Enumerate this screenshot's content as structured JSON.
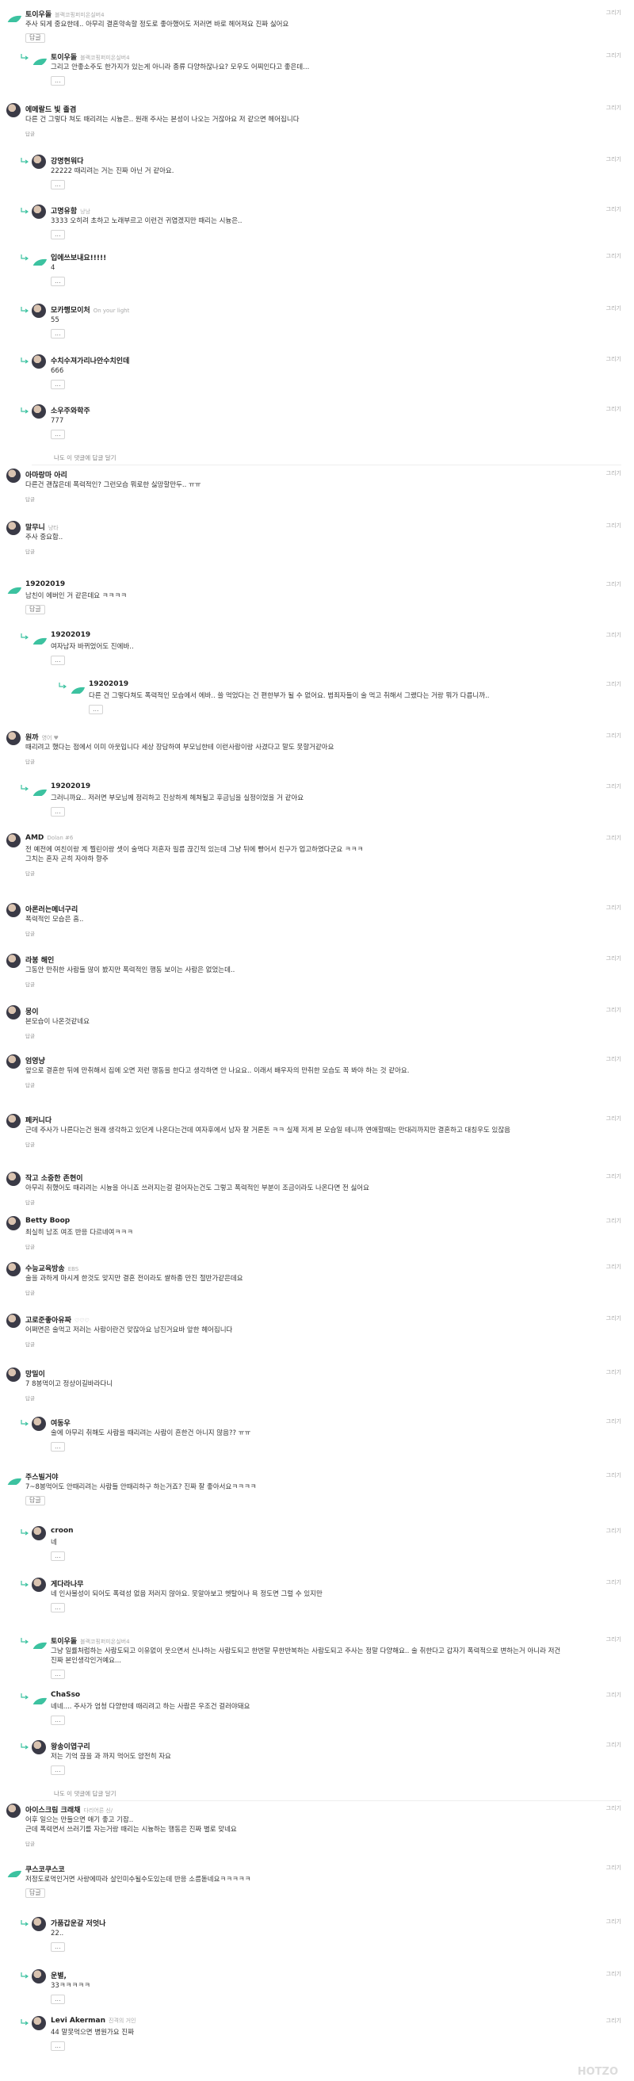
{
  "report_label": "그리기",
  "reply_label": "답글",
  "more_label": "...",
  "view_replies_label": "나도 이 댓글에 답글 달기",
  "watermark": "HOTZO",
  "leaf_color": "#3cc2a0",
  "comments": [
    {
      "nick": "토이우돌",
      "tag": "블랙코핑퍼미온실버4",
      "body": "주사 되게 중요한데.. 아무리 결혼약속할 정도로 좋아했어도 저러면 바로 헤어져요 진짜 싫어요",
      "avatar": "leaf",
      "depth": 0
    },
    {
      "nick": "토이우돌",
      "tag": "블랙코핑퍼미온실버4",
      "body": "그리고 안좋소주도 한가지가 있는게 아니라 종류 다양하잖나요? 모우도 어찌인다고 좋은데...",
      "avatar": "leaf",
      "depth": 1
    },
    {
      "nick": "에메랄드 빛 졸겸",
      "tag": "",
      "body": "다른 건 그렇다 쳐도 때리려는 시늉은.. 원래 주사는 본성이 나오는 거잖아요 저 같으면 헤어집니다",
      "avatar": "photo",
      "depth": 0
    },
    {
      "nick": "강명현워다",
      "tag": "",
      "body": "22222 때리려는 거는 진짜 아닌 거 같아요.",
      "avatar": "photo",
      "depth": 1
    },
    {
      "nick": "고명유함",
      "tag": "낭낭",
      "body": "3333 오히려 초하고 노래부르고 이런건 귀엽겠지만 때리는 시늉은..",
      "avatar": "photo",
      "depth": 1
    },
    {
      "nick": "입에쓰보내요!!!!!",
      "tag": "",
      "body": "4",
      "avatar": "leaf",
      "depth": 1
    },
    {
      "nick": "모카행모이처",
      "tag": "On your light",
      "body": "55",
      "avatar": "photo",
      "depth": 1
    },
    {
      "nick": "수치수져가리나안수치인데",
      "tag": "",
      "body": "666",
      "avatar": "photo",
      "depth": 1
    },
    {
      "nick": "소우주와학주",
      "tag": "",
      "body": "777",
      "avatar": "photo",
      "depth": 1
    },
    {
      "viewmore": true,
      "depth": 1
    },
    {
      "nick": "아마랑마 아리",
      "tag": "",
      "body": "다른건 괜찮은데 폭력적인? 그런모습 뭐로한 싫망할만두.. ㅠㅠ",
      "avatar": "photo",
      "depth": 0
    },
    {
      "nick": "말무니",
      "tag": "냥타",
      "body": "주사 중요함..",
      "avatar": "photo",
      "depth": 0
    },
    {
      "nick": "19202019",
      "tag": "",
      "body": "남친이 에버인 거 같은데요 ㅋㅋㅋㅋ",
      "avatar": "leaf",
      "depth": 0
    },
    {
      "nick": "19202019",
      "tag": "",
      "body": "여자남자 바뀌었어도 진에바..",
      "avatar": "leaf",
      "depth": 1
    },
    {
      "nick": "19202019",
      "tag": "",
      "body": "다른 건 그렇다쳐도 폭력적인 모습에서 에바.. 쓸 먹었다는 건 편한부가 될 수 없어요. 범죄자들이 술 먹고 취해서 그랬다는 거랑 뭐가 다릅니까..",
      "avatar": "leaf",
      "depth": 2
    },
    {
      "nick": "원까",
      "tag": "영어 ♥",
      "body": "때리려고 했다는 점에서 이미 아웃입니다 세상 장담하여 부모님한테 이런사람이랑 사겼다고 말도 못할거같아요",
      "avatar": "photo",
      "depth": 0
    },
    {
      "nick": "19202019",
      "tag": "",
      "body": "그러니까요.. 저러면 부모님께 정리하고 진상하게 헤쳐될고 후금님을 실정이었을 거 같아요",
      "avatar": "leaf",
      "depth": 1
    },
    {
      "nick": "AMD",
      "tag": "Dolan #6",
      "body": "전 예전에 여친이랑 계 찔린이랑 셋이 술먹다 저혼자 필름 끊긴적 있는데 그냥 뒤에 빵어서 친구가 업고하였다군요 ㅋㅋㅋ\n그치는 혼자 곤히 자야하 향주",
      "avatar": "photo",
      "depth": 0
    },
    {
      "nick": "아론러는메너구리",
      "tag": "",
      "body": "폭력적인 모습은 흠..",
      "avatar": "photo",
      "depth": 0
    },
    {
      "nick": "라봉 해인",
      "tag": "",
      "body": "그동안 만취한 사람들 많이 봤지만 폭력적인 행동 보이는 사람은 없었는데..",
      "avatar": "photo",
      "depth": 0
    },
    {
      "nick": "몽이",
      "tag": "",
      "body": "본모습이 나온것같네요",
      "avatar": "photo",
      "depth": 0
    },
    {
      "nick": "엄영냥",
      "tag": "",
      "body": "앞으로 결혼한 뒤에 만취해서 집에 오면 저런 행동을 한다고 생각하면 안 나요요.. 이래서 배우자의 만취한 모습도 꼭 봐야 하는 것 같아요.",
      "avatar": "photo",
      "depth": 0
    },
    {
      "nick": "페커니다",
      "tag": "",
      "body": "근데 주사가 나른다는건 원래 생각하고 있던게 나온다는건데 여자후에서 남자 잘 거론돈 ㅋㅋ 실제 저게 본 모습일 테니까 연애할때는 만대리까지만 결혼하고 대칭우도 있잖음",
      "avatar": "photo",
      "depth": 0
    },
    {
      "nick": "작고 소중한 존현이",
      "tag": "",
      "body": "아무리 취했어도 때리려는 시늉을 아니죠 쓰러지는걸 걸어자는건도 그렇고 폭력적인 부분이 조금이라도 나온다면 전 싫어요",
      "avatar": "photo",
      "depth": 0
    },
    {
      "nick": "Betty Boop",
      "tag": "",
      "body": "최실히 남조 여조 반응 다르네여ㅋㅋㅋ",
      "avatar": "photo",
      "depth": 0
    },
    {
      "nick": "수능교육방송",
      "tag": "EBS",
      "body": "술을 과하게 마시게 한것도 맞지만 결혼 전이라도 쌀하종 만진 절반가같은데요",
      "avatar": "photo",
      "depth": 0
    },
    {
      "nick": "고로준좋아유짜",
      "tag": "♡♡♡",
      "body": "어쩌면은 술먹고 저러는 사람이란건 맞잖아요 남진거요바 앞한 헤어집니다",
      "avatar": "photo",
      "depth": 0
    },
    {
      "nick": "망밀이",
      "tag": "",
      "body": "7 8봉먹이고 정상이길바라다니",
      "avatar": "photo",
      "depth": 0
    },
    {
      "nick": "여동우",
      "tag": "",
      "body": "술에 아무리 취해도 사람을 때리려는 사람이 흔한건 아니지 않음?? ㅠㅠ",
      "avatar": "photo",
      "depth": 1
    },
    {
      "nick": "주스빌거야",
      "tag": "",
      "body": "7~8봉먹어도 안때리려는 사람들 안때리하구 하는거죠? 진짜 잘 좋아서요ㅋㅋㅋㅋ",
      "avatar": "leaf",
      "depth": 0
    },
    {
      "nick": "croon",
      "tag": "",
      "body": "네",
      "avatar": "photo",
      "depth": 1
    },
    {
      "nick": "게다라나무",
      "tag": "",
      "body": "네 인사불성이 되어도 폭력성 없음 저러지 않아요. 못알아보고 헷탈어나 욕 정도면 그럴 수 있지만",
      "avatar": "photo",
      "depth": 1
    },
    {
      "nick": "토이우돌",
      "tag": "블랙코핑퍼미온실버4",
      "body": "그냥 일률처럼하는 사람도되고 이유없이 웃으면서 신나하는 사람도되고 한번말 무한반복하는 사람도되고 주사는 정말 다양해요.. 술 취한다고 갑자기 폭력적으로 변하는거 아니라 저건\n진짜 본인생각인거예요...",
      "avatar": "leaf",
      "depth": 1
    },
    {
      "nick": "ChaSso",
      "tag": "",
      "body": "네네.... 주사가 엄청 다양한데 때리려고 하는 사람은 우조건 걸러야돼요",
      "avatar": "leaf",
      "depth": 1
    },
    {
      "nick": "왕송이엽구리",
      "tag": "",
      "body": "저는 기억 끊을 과 까지 먹어도 얌전히 자요",
      "avatar": "photo",
      "depth": 1
    },
    {
      "viewmore": true,
      "depth": 1
    },
    {
      "nick": "아이스크림 크래채",
      "tag": "다리어른 신/",
      "body": "어후 일으는 만들으면 애기 좋고 기잡..\n근데 폭력면서 쓰러기를 자는거랑 때리는 시늉하는 행동은 진짜 별로 맞네요",
      "avatar": "photo",
      "depth": 0
    },
    {
      "nick": "쿠스코쿠스코",
      "tag": "",
      "body": "저정도로먹인거면 사랑에따라 살인미수될수도있는데 반응 소름돋네요ㅋㅋㅋㅋㅋ",
      "avatar": "leaf",
      "depth": 0
    },
    {
      "nick": "가품갑운갈 저엇나",
      "tag": "",
      "body": "22..",
      "avatar": "photo",
      "depth": 1
    },
    {
      "nick": "운별,",
      "tag": "",
      "body": "33ㅋㅋㅋㅋㅋ",
      "avatar": "photo",
      "depth": 1
    },
    {
      "nick": "Levi Akerman",
      "tag": "진격의 거인",
      "body": "44 말못먹으면 병원가요 진짜",
      "avatar": "photo",
      "depth": 1
    }
  ]
}
